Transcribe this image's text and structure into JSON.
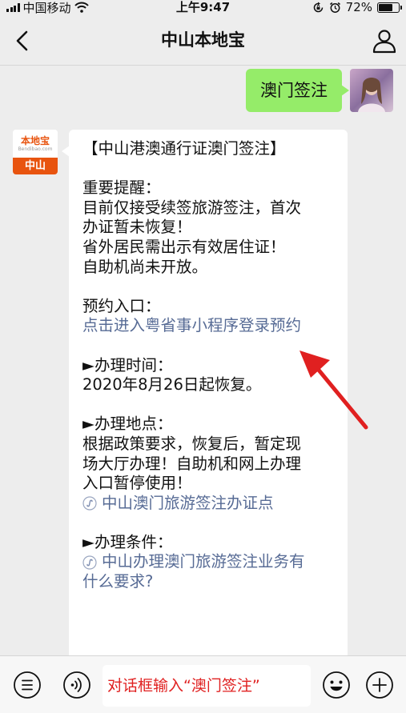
{
  "status_bar": {
    "carrier": "中国移动",
    "time": "上午9:47",
    "battery_percent": "72%",
    "battery_level": 0.72
  },
  "nav": {
    "title": "中山本地宝",
    "back_icon": "chevron-left-icon",
    "profile_icon": "person-icon"
  },
  "messages": {
    "outgoing_text": "澳门签注",
    "bot_avatar": {
      "brand": "本地宝",
      "url": "Bendibao.com",
      "city": "中山"
    },
    "incoming": {
      "title": "【中山港澳通行证澳门签注】",
      "notice_heading": "重要提醒：",
      "notice_lines": [
        "目前仅接受续签旅游签注，首次",
        "办证暂未恢复！",
        "省外居民需出示有效居住证！",
        "自助机尚未开放。"
      ],
      "booking_heading": "预约入口：",
      "booking_link": "点击进入粤省事小程序登录预约",
      "time_heading": "►办理时间：",
      "time_text": "2020年8月26日起恢复。",
      "place_heading": "►办理地点：",
      "place_lines": [
        "根据政策要求，恢复后，暂定现",
        "场大厅办理！自助机和网上办理",
        "入口暂停使用！"
      ],
      "place_link": "中山澳门旅游签注办证点",
      "condition_heading": "►办理条件：",
      "condition_link_lines": [
        "中山办理澳门旅游签注业务有",
        "什么要求?"
      ]
    }
  },
  "bottom_bar": {
    "input_text": "对话框输入“澳门签注”",
    "menu_icon": "menu-list-icon",
    "voice_icon": "voice-icon",
    "emoji_icon": "emoji-icon",
    "plus_icon": "plus-icon"
  },
  "colors": {
    "outgoing_bubble": "#95ec69",
    "link": "#576b95",
    "annotation": "#e02020",
    "brand_orange": "#e8540f"
  }
}
